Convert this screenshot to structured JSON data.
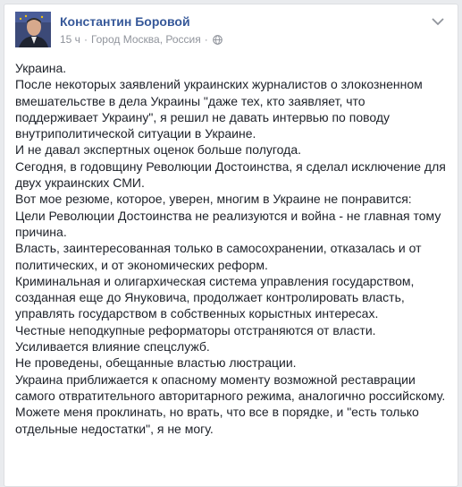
{
  "post": {
    "author": "Константин Боровой",
    "time": "15 ч",
    "separator1": "·",
    "location": "Город Москва, Россия",
    "separator2": "·",
    "privacy_icon": "globe-icon",
    "menu_icon": "chevron-down-icon",
    "text": "Украина.\nПосле некоторых заявлений украинских журналистов о злокозненном вмешательстве в дела Украины \"даже тех, кто заявляет, что поддерживает Украину\", я решил не давать интервью по поводу внутриполитической ситуации в Украине.\nИ не давал экспертных оценок больше полугода.\nСегодня, в годовщину Революции Достоинства, я сделал исключение для двух украинских СМИ.\nВот мое резюме, которое, уверен, многим в Украине не понравится:\nЦели Революции Достоинства не реализуются и война - не главная тому причина.\nВласть, заинтересованная только в самосохранении, отказалась и от политических, и от экономических реформ.\nКриминальная и олигархическая система управления государством, созданная еще до Януковича, продолжает контролировать власть, управлять государством в собственных корыстных интересах.\nЧестные неподкупные реформаторы отстраняются от власти.\nУсиливается влияние спецслужб.\nНе проведены, обещанные властью люстрации.\nУкраина приближается к опасному моменту возможной реставрации самого отвратительного авторитарного режима, аналогично российскому.\nМожете меня проклинать, но врать, что все в порядке, и \"есть только отдельные недостатки\", я не могу."
  },
  "colors": {
    "author_link": "#365899",
    "meta_text": "#90949c",
    "body_text": "#1d2129",
    "background": "#e9ebee"
  }
}
